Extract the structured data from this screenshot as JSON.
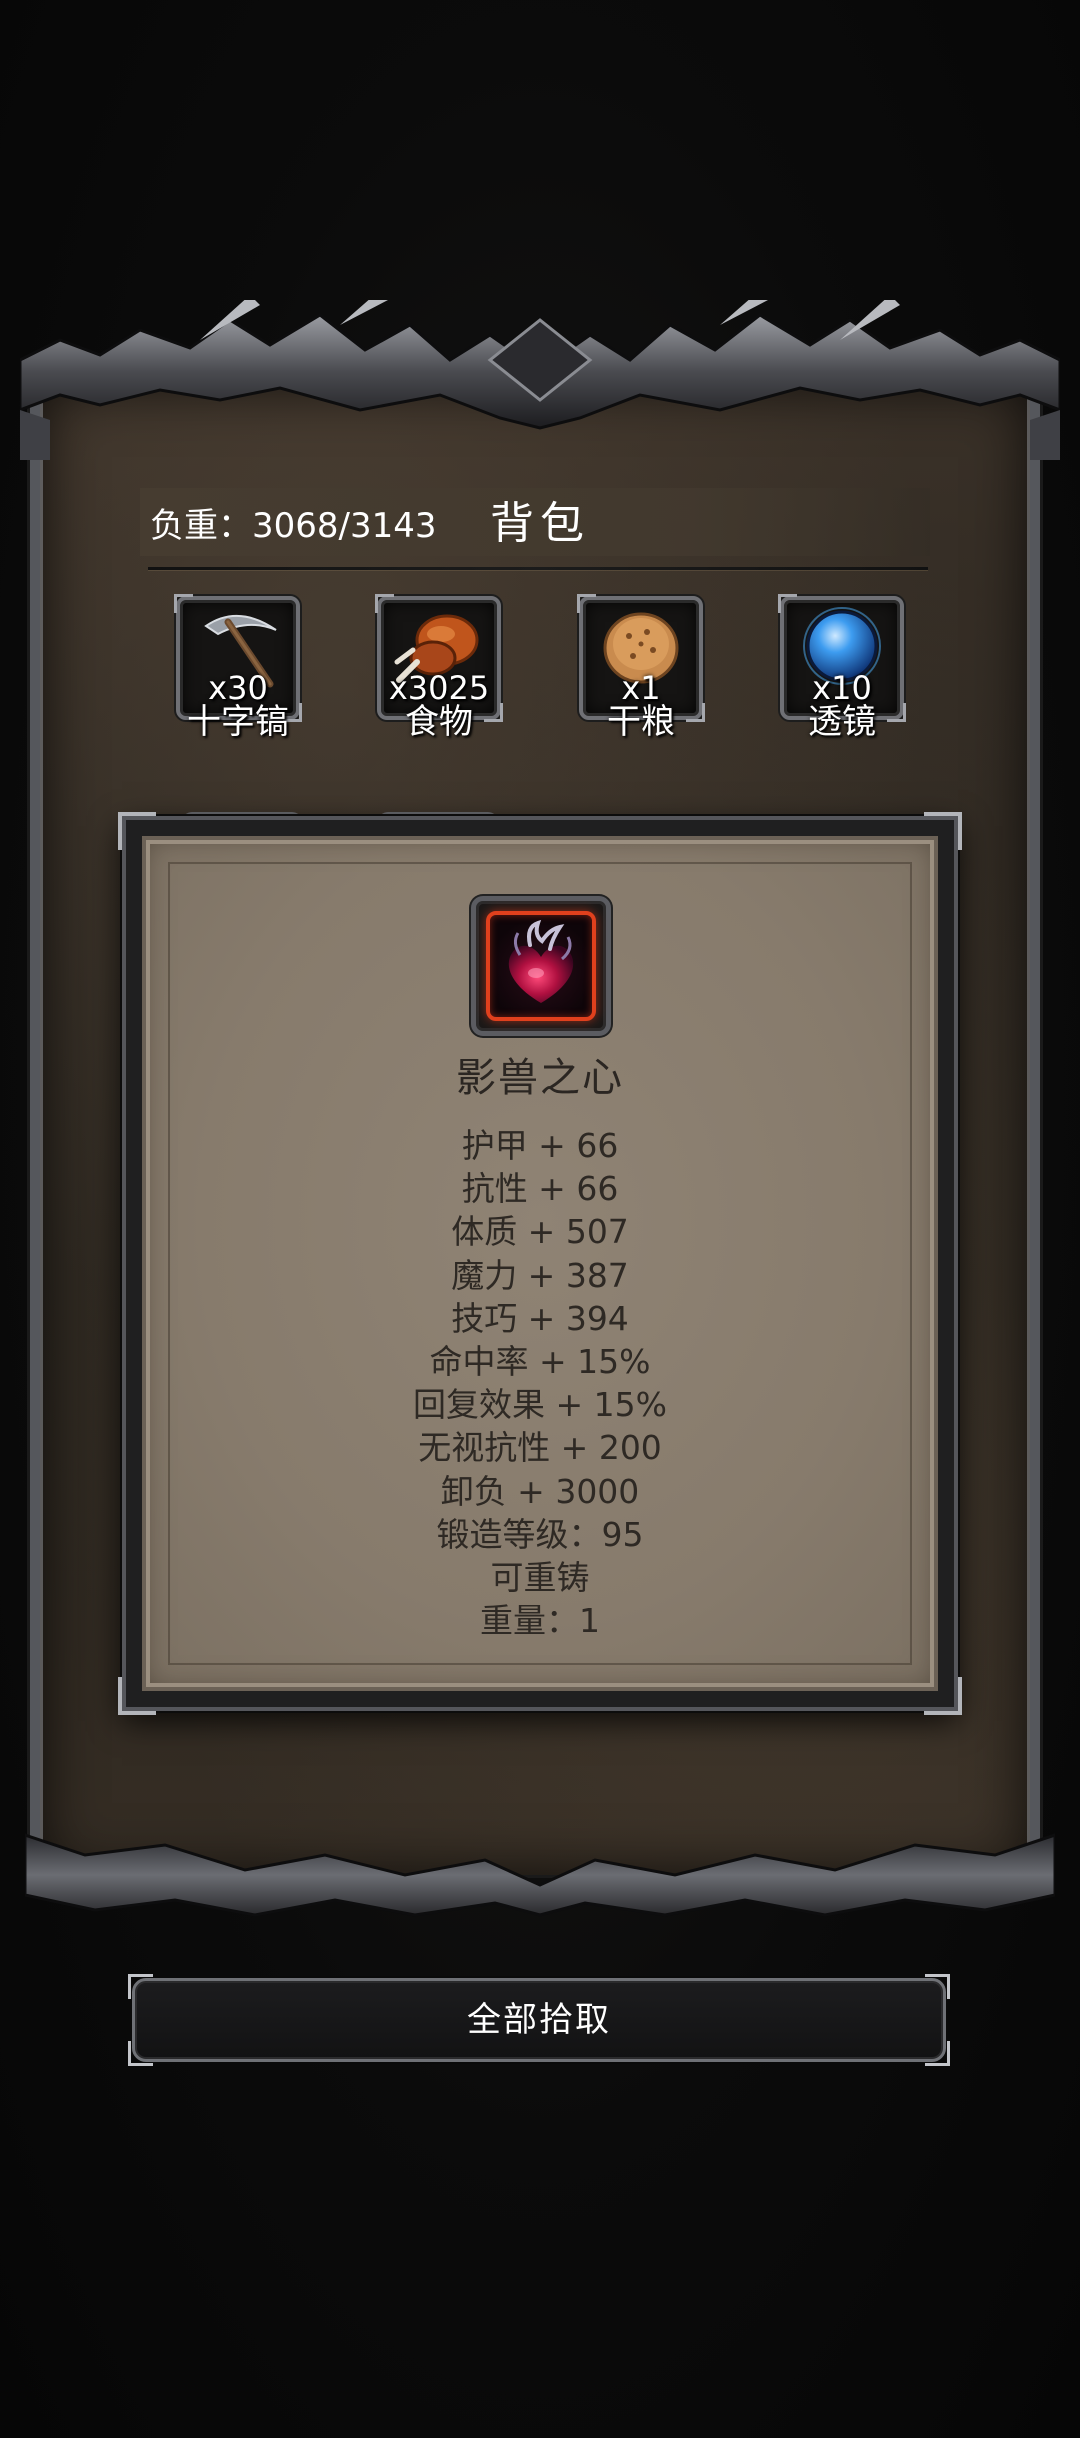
{
  "header": {
    "weight_text": "负重：3068/3143",
    "title": "背包"
  },
  "slots": [
    {
      "name": "十字镐",
      "qty": "x30",
      "icon": "pickaxe-icon"
    },
    {
      "name": "食物",
      "qty": "x3025",
      "icon": "meat-icon"
    },
    {
      "name": "干粮",
      "qty": "x1",
      "icon": "biscuit-icon"
    },
    {
      "name": "透镜",
      "qty": "x10",
      "icon": "lens-orb-icon"
    }
  ],
  "tooltip": {
    "item_name": "影兽之心",
    "icon": "shadow-beast-heart-icon",
    "rarity_color": "#e0401d",
    "stats": [
      "护甲 + 66",
      "抗性 + 66",
      "体质 + 507",
      "魔力 + 387",
      "技巧 + 394",
      "命中率 + 15%",
      "回复效果 + 15%",
      "无视抗性 + 200",
      "卸负 + 3000",
      "锻造等级：95",
      "可重铸",
      "重量：1"
    ]
  },
  "footer": {
    "pickup_all_label": "全部拾取"
  }
}
